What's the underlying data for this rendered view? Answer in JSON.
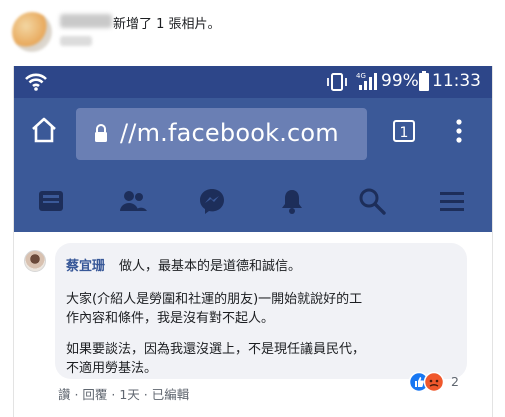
{
  "post": {
    "action_text": "新增了 1 張相片。"
  },
  "status_bar": {
    "battery_pct": "99%",
    "time": "11:33",
    "network": "4G"
  },
  "browser": {
    "url": "//m.facebook.com",
    "tab_count": "1"
  },
  "comment": {
    "author": "蔡宜珊",
    "line1": "做人，最基本的是道德和誠信。",
    "line2": "大家(介紹人是勞圍和社運的朋友)一開始就說好的工",
    "line3": "作內容和條件，我是沒有對不起人。",
    "line4": "如果要談法，因為我還沒選上，不是現任議員民代，",
    "line5": "不適用勞基法。",
    "actions": "讚 · 回覆 · 1天 · 已編輯",
    "reaction_count": "2"
  },
  "colors": {
    "status_bar": "#2d4689",
    "fb_blue": "#3b5998",
    "url_field": "#6a7fb4",
    "author_link": "#385898"
  },
  "icons": {
    "status": [
      "wifi-icon",
      "vibrate-icon",
      "signal-icon",
      "battery-icon"
    ],
    "browser": [
      "home-icon",
      "lock-icon",
      "tabs-icon",
      "menu-icon"
    ],
    "nav": [
      "news-feed-icon",
      "friends-icon",
      "messenger-icon",
      "notifications-icon",
      "search-icon",
      "hamburger-icon"
    ],
    "reactions": [
      "like-reaction-icon",
      "angry-reaction-icon"
    ]
  }
}
